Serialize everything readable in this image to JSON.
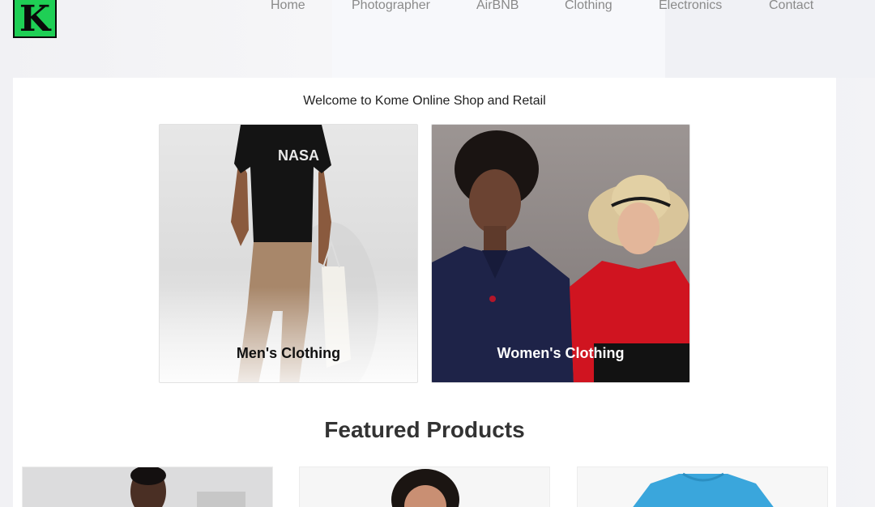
{
  "brand": {
    "logo_letter": "K"
  },
  "nav": {
    "items": [
      {
        "label": "Home"
      },
      {
        "label": "Photographer"
      },
      {
        "label": "AirBNB"
      },
      {
        "label": "Clothing"
      },
      {
        "label": "Electronics"
      },
      {
        "label": "Contact"
      }
    ]
  },
  "welcome": "Welcome to Kome Online Shop and Retail",
  "categories": [
    {
      "label": "Men's Clothing"
    },
    {
      "label": "Women's Clothing"
    }
  ],
  "featured_heading": "Featured Products",
  "colors": {
    "logo_bg": "#1fcf55",
    "nav_text": "#8a8a8a",
    "card_bg": "#ffffff"
  }
}
